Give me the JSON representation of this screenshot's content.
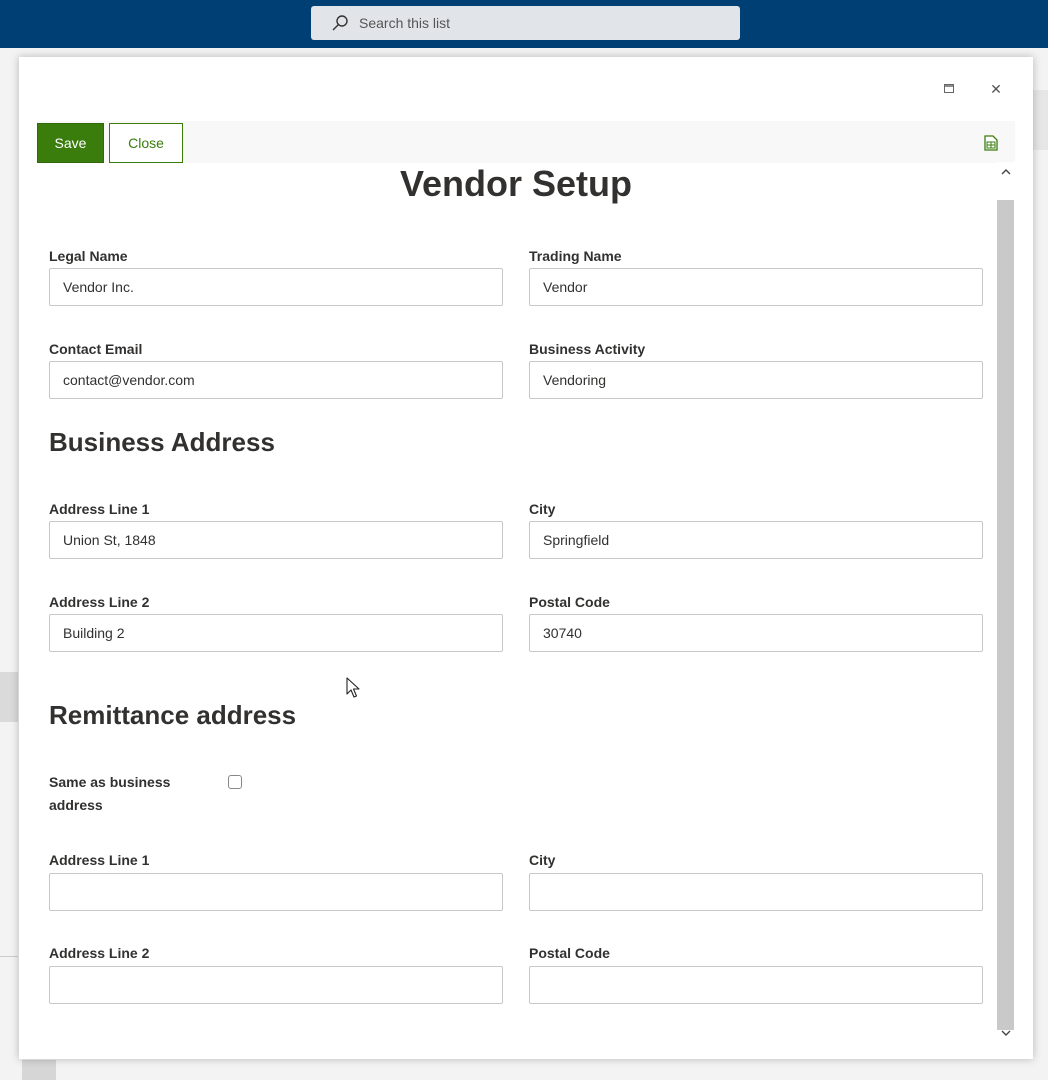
{
  "search": {
    "placeholder": "Search this list"
  },
  "window": {
    "maximize_glyph": "□",
    "close_glyph": "✕"
  },
  "toolbar": {
    "save_label": "Save",
    "close_label": "Close"
  },
  "form": {
    "title": "Vendor Setup",
    "fields": {
      "legal_name": {
        "label": "Legal Name",
        "value": "Vendor Inc."
      },
      "trading_name": {
        "label": "Trading Name",
        "value": "Vendor"
      },
      "contact_email": {
        "label": "Contact Email",
        "value": "contact@vendor.com"
      },
      "business_activity": {
        "label": "Business Activity",
        "value": "Vendoring"
      }
    },
    "business_address": {
      "heading": "Business Address",
      "address_line1": {
        "label": "Address Line 1",
        "value": "Union St, 1848"
      },
      "city": {
        "label": "City",
        "value": "Springfield"
      },
      "address_line2": {
        "label": "Address Line 2",
        "value": "Building 2"
      },
      "postal_code": {
        "label": "Postal Code",
        "value": "30740"
      }
    },
    "remittance_address": {
      "heading": "Remittance address",
      "same_as_label_line1": "Same as business",
      "same_as_label_line2": "address",
      "same_as_checked": false,
      "address_line1": {
        "label": "Address Line 1",
        "value": ""
      },
      "city": {
        "label": "City",
        "value": ""
      },
      "address_line2": {
        "label": "Address Line 2",
        "value": ""
      },
      "postal_code": {
        "label": "Postal Code",
        "value": ""
      }
    }
  },
  "icons": {
    "search": "search-icon",
    "maximize": "maximize-icon",
    "close": "close-icon",
    "export": "excel-export-icon",
    "scroll_up": "chevron-up-icon",
    "scroll_down": "chevron-down-icon",
    "cursor": "mouse-pointer-icon"
  },
  "colors": {
    "topbar": "#003f74",
    "accent": "#3a7d0d"
  }
}
